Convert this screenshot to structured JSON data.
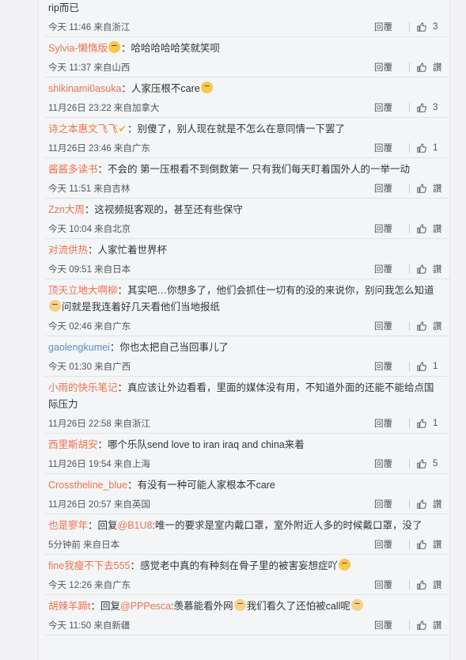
{
  "reply_label": "回覆",
  "comments": [
    {
      "user": "",
      "text": "rip而已",
      "meta": "今天 11:46 来自浙江",
      "likes": "3"
    },
    {
      "user": "Sylvia-懒惰版",
      "text": "：哈哈哈哈哈笑就笑呗",
      "meta": "今天 11:37 来自山西",
      "likes": "讚"
    },
    {
      "user": "shikinami0asuka",
      "text": "：人家压根不care",
      "meta": "11月26日 23:22 来自加拿大",
      "likes": "3"
    },
    {
      "user": "诗之本惠文飞飞",
      "text": "：别傻了，别人现在就是不怎么在意同情一下罢了",
      "meta": "11月26日 23:46 来自广东",
      "likes": "1"
    },
    {
      "user": "酱酱多读书",
      "text": "：不会的 第一压根看不到倒数第一 只有我们每天盯着国外人的一举一动",
      "meta": "今天 11:51 来自吉林",
      "likes": "讚"
    },
    {
      "user": "Zzn大周",
      "text": "：这视频挺客观的，甚至还有些保守",
      "meta": "今天 10:04 来自北京",
      "likes": "讚"
    },
    {
      "user": "对流供热",
      "text": "：人家忙着世界杯",
      "meta": "今天 09:51 来自日本",
      "likes": "讚"
    },
    {
      "user": "顶天立地大啊柳",
      "text": "：其实吧…你想多了，他们会抓住一切有的没的来说你，别问我怎么知道",
      "text2": "问就是我连着好几天看他们当地报纸",
      "meta": "今天 02:46 来自广东",
      "likes": "讚"
    },
    {
      "user": "gaolengkumei",
      "text": "：你也太把自己当回事儿了",
      "meta": "今天 01:30 来自广西",
      "likes": "1"
    },
    {
      "user": "小雨的快乐笔记",
      "text": "：真应该让外边看看，里面的媒体没有用，不知道外面的还能不能给点国际压力",
      "meta": "11月26日 22:58 来自浙江",
      "likes": "1"
    },
    {
      "user": "西里斯胡安",
      "text": "：哪个乐队send love to iran iraq and china来着",
      "meta": "11月26日 19:54 来自上海",
      "likes": "5"
    },
    {
      "user": "Crosstheline_blue",
      "text": "：有没有一种可能人家根本不care",
      "meta": "11月26日 20:57 来自英国",
      "likes": "讚"
    },
    {
      "user": "也是寥年",
      "text": "：回复",
      "mention": "@B1U8",
      "text_after": ":唯一的要求是室内戴口罩，室外附近人多的时候戴口罩，没了",
      "meta": "5分钟前 来自日本",
      "likes": "讚"
    },
    {
      "user": "fine我瘦不下去555",
      "text": "：感觉老中真的有种刻在骨子里的被害妄想症吖",
      "meta": "今天 12:26 来自广东",
      "likes": "讚"
    },
    {
      "user": "胡辣羊蹄t",
      "text": "：回复",
      "mention": "@PPPesca",
      "text_after": ":羡慕能看外网",
      "text_after2": "我们看久了还怕被call呢",
      "meta": "今天 11:50 来自新疆",
      "likes": "讚"
    }
  ]
}
